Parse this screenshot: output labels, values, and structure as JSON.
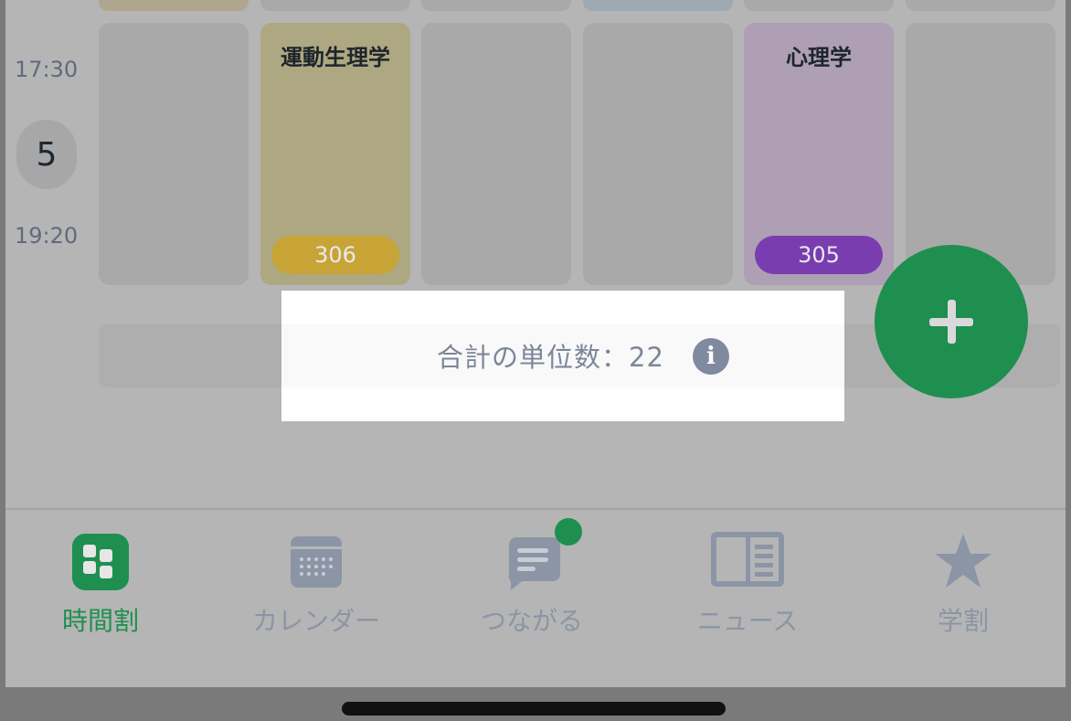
{
  "timetable": {
    "period": {
      "number": "5",
      "start_time": "17:30",
      "end_time": "19:20"
    },
    "courses": [
      {
        "title": "運動生理学",
        "room": "306",
        "card_color": "#ada881",
        "pill_color": "#c8a437"
      },
      {
        "title": "心理学",
        "room": "305",
        "card_color": "#ae9fb4",
        "pill_color": "#7a3db0"
      }
    ]
  },
  "credits": {
    "label": "合計の単位数：22"
  },
  "tabs": [
    {
      "label": "時間割",
      "icon": "timetable-grid-icon",
      "active": true
    },
    {
      "label": "カレンダー",
      "icon": "calendar-icon",
      "active": false
    },
    {
      "label": "つながる",
      "icon": "chat-bubble-icon",
      "active": false,
      "badge": true
    },
    {
      "label": "ニュース",
      "icon": "newspaper-icon",
      "active": false
    },
    {
      "label": "学割",
      "icon": "star-icon",
      "active": false
    }
  ],
  "colors": {
    "accent_green": "#1e8f4f",
    "inactive_gray": "#8b95a5"
  }
}
